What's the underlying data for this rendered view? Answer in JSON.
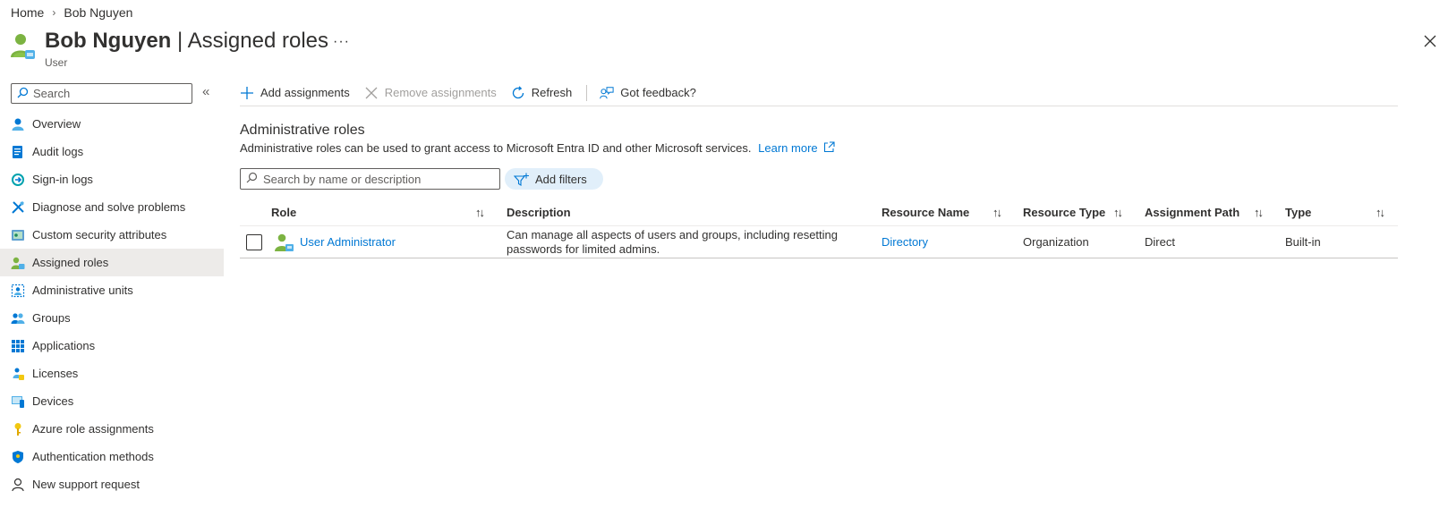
{
  "breadcrumb": {
    "home": "Home",
    "current": "Bob Nguyen"
  },
  "header": {
    "name": "Bob Nguyen",
    "separator": " | ",
    "page": "Assigned roles",
    "subtitle": "User",
    "more": "···"
  },
  "sidebar": {
    "search_placeholder": "Search",
    "collapse": "«",
    "items": [
      {
        "label": "Overview",
        "icon": "user-overview-icon"
      },
      {
        "label": "Audit logs",
        "icon": "audit-logs-icon"
      },
      {
        "label": "Sign-in logs",
        "icon": "sign-in-logs-icon"
      },
      {
        "label": "Diagnose and solve problems",
        "icon": "diagnose-icon"
      },
      {
        "label": "Custom security attributes",
        "icon": "security-attributes-icon"
      },
      {
        "label": "Assigned roles",
        "icon": "assigned-roles-icon",
        "active": true
      },
      {
        "label": "Administrative units",
        "icon": "admin-units-icon"
      },
      {
        "label": "Groups",
        "icon": "groups-icon"
      },
      {
        "label": "Applications",
        "icon": "applications-icon"
      },
      {
        "label": "Licenses",
        "icon": "licenses-icon"
      },
      {
        "label": "Devices",
        "icon": "devices-icon"
      },
      {
        "label": "Azure role assignments",
        "icon": "key-icon"
      },
      {
        "label": "Authentication methods",
        "icon": "shield-icon"
      },
      {
        "label": "New support request",
        "icon": "support-icon"
      }
    ]
  },
  "toolbar": {
    "add": "Add assignments",
    "remove": "Remove assignments",
    "refresh": "Refresh",
    "feedback": "Got feedback?"
  },
  "section": {
    "title": "Administrative roles",
    "description": "Administrative roles can be used to grant access to Microsoft Entra ID and other Microsoft services.",
    "learn_more": "Learn more"
  },
  "filters": {
    "search_placeholder": "Search by name or description",
    "add_filters": "Add filters"
  },
  "table": {
    "columns": [
      "Role",
      "Description",
      "Resource Name",
      "Resource Type",
      "Assignment Path",
      "Type"
    ],
    "sort_glyph": "↑↓",
    "rows": [
      {
        "role": "User Administrator",
        "description": "Can manage all aspects of users and groups, including resetting passwords for limited admins.",
        "resource_name": "Directory",
        "resource_type": "Organization",
        "assignment_path": "Direct",
        "type": "Built-in"
      }
    ]
  },
  "colors": {
    "accent": "#0078d4",
    "active_bg": "#edebe9",
    "pill_bg": "#e1effa",
    "disabled": "#a19f9d"
  }
}
